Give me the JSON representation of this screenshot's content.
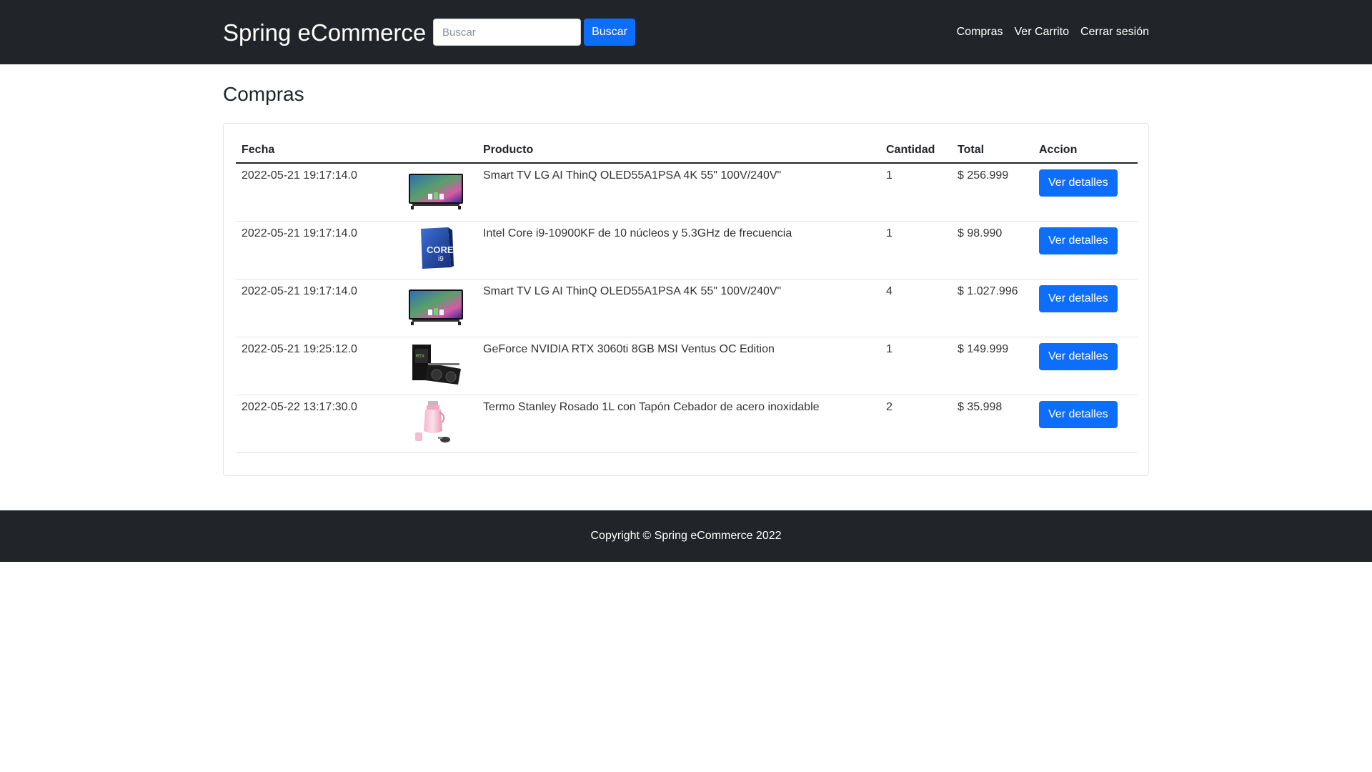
{
  "navbar": {
    "brand": "Spring eCommerce",
    "search_placeholder": "Buscar",
    "search_button": "Buscar",
    "links": [
      "Compras",
      "Ver Carrito",
      "Cerrar sesión"
    ]
  },
  "main": {
    "title": "Compras",
    "table": {
      "headers": [
        "Fecha",
        "",
        "Producto",
        "Cantidad",
        "Total",
        "Accion"
      ],
      "rows": [
        {
          "fecha": "2022-05-21 19:17:14.0",
          "image": "tv-icon",
          "producto": "Smart TV LG AI ThinQ OLED55A1PSA 4K 55\" 100V/240V\"",
          "cantidad": "1",
          "total": "$ 256.999",
          "action": "Ver detalles"
        },
        {
          "fecha": "2022-05-21 19:17:14.0",
          "image": "cpu-box-icon",
          "producto": "Intel Core i9-10900KF de 10 núcleos y 5.3GHz de frecuencia",
          "cantidad": "1",
          "total": "$ 98.990",
          "action": "Ver detalles"
        },
        {
          "fecha": "2022-05-21 19:17:14.0",
          "image": "tv-icon",
          "producto": "Smart TV LG AI ThinQ OLED55A1PSA 4K 55\" 100V/240V\"",
          "cantidad": "4",
          "total": "$ 1.027.996",
          "action": "Ver detalles"
        },
        {
          "fecha": "2022-05-21 19:25:12.0",
          "image": "gpu-icon",
          "producto": "GeForce NVIDIA RTX 3060ti 8GB MSI Ventus OC Edition",
          "cantidad": "1",
          "total": "$ 149.999",
          "action": "Ver detalles"
        },
        {
          "fecha": "2022-05-22 13:17:30.0",
          "image": "thermos-icon",
          "producto": "Termo Stanley Rosado 1L con Tapón Cebador de acero inoxidable",
          "cantidad": "2",
          "total": "$ 35.998",
          "action": "Ver detalles"
        }
      ]
    }
  },
  "footer": {
    "text": "Copyright © Spring eCommerce 2022"
  },
  "colors": {
    "navbar_bg": "#212529",
    "primary": "#0d6efd",
    "border": "#dee2e6"
  }
}
